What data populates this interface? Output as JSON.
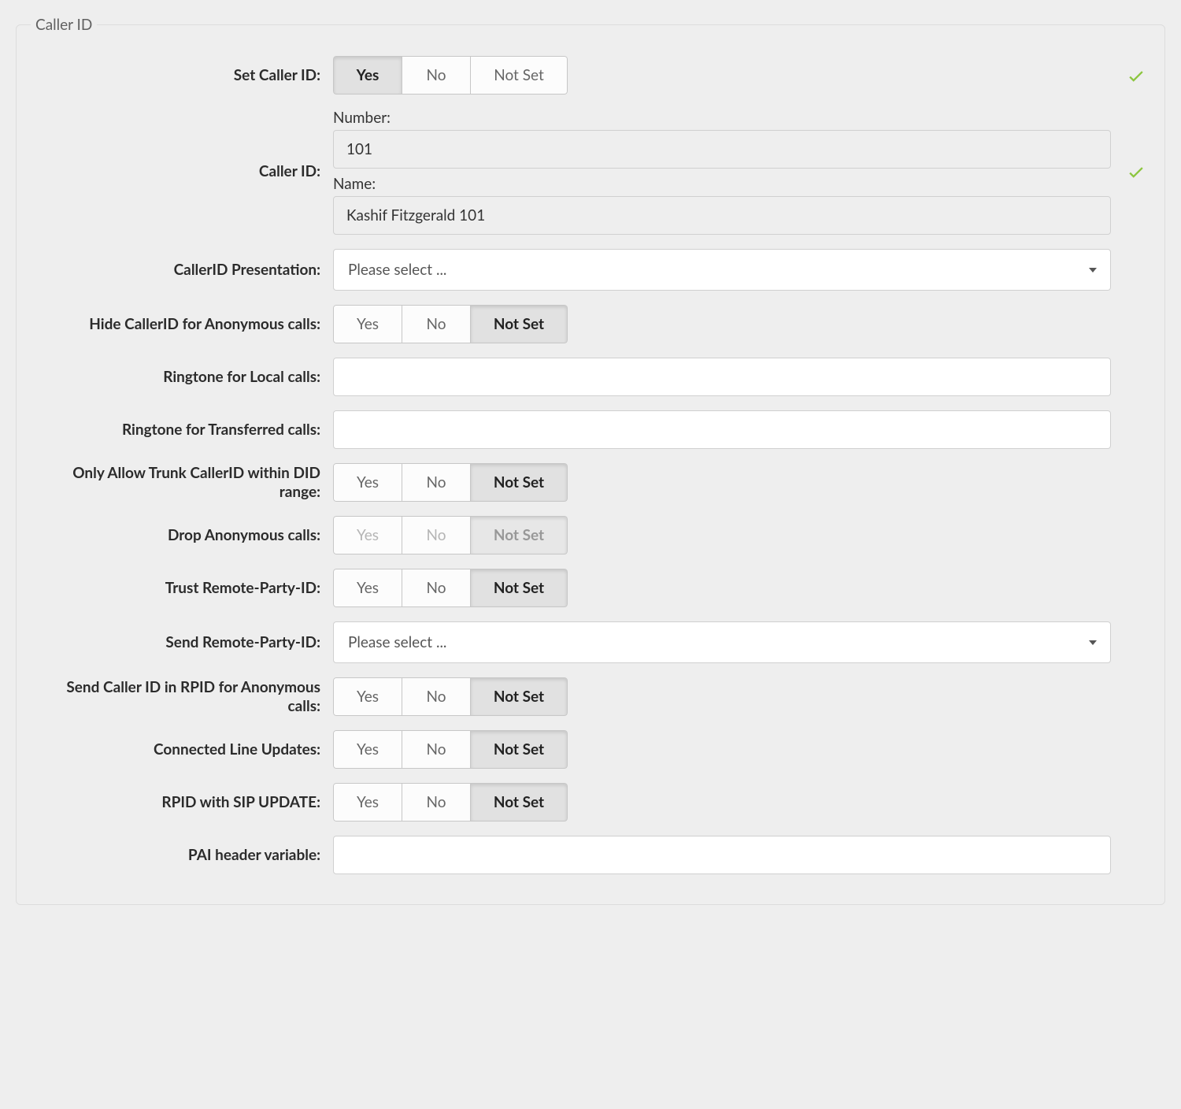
{
  "section": {
    "legend": "Caller ID"
  },
  "toggle_options": {
    "yes": "Yes",
    "no": "No",
    "notset": "Not Set"
  },
  "select_placeholder": "Please select ...",
  "fields": {
    "set_caller_id": {
      "label": "Set Caller ID:",
      "value": "yes",
      "has_check": true
    },
    "caller_id": {
      "label": "Caller ID:",
      "number_label": "Number:",
      "number_value": "101",
      "name_label": "Name:",
      "name_value": "Kashif Fitzgerald 101",
      "has_check": true
    },
    "presentation": {
      "label": "CallerID Presentation:"
    },
    "hide_anon": {
      "label": "Hide CallerID for Anonymous calls:",
      "value": "notset"
    },
    "ringtone_local": {
      "label": "Ringtone for Local calls:",
      "value": ""
    },
    "ringtone_transferred": {
      "label": "Ringtone for Transferred calls:",
      "value": ""
    },
    "trunk_did": {
      "label": "Only Allow Trunk CallerID within DID range:",
      "value": "notset"
    },
    "drop_anon": {
      "label": "Drop Anonymous calls:",
      "value": "notset",
      "disabled": true
    },
    "trust_rpid": {
      "label": "Trust Remote-Party-ID:",
      "value": "notset"
    },
    "send_rpid": {
      "label": "Send Remote-Party-ID:"
    },
    "rpid_anon": {
      "label": "Send Caller ID in RPID for Anonymous calls:",
      "value": "notset"
    },
    "connected_line": {
      "label": "Connected Line Updates:",
      "value": "notset"
    },
    "rpid_update": {
      "label": "RPID with SIP UPDATE:",
      "value": "notset"
    },
    "pai_header": {
      "label": "PAI header variable:",
      "value": ""
    }
  }
}
